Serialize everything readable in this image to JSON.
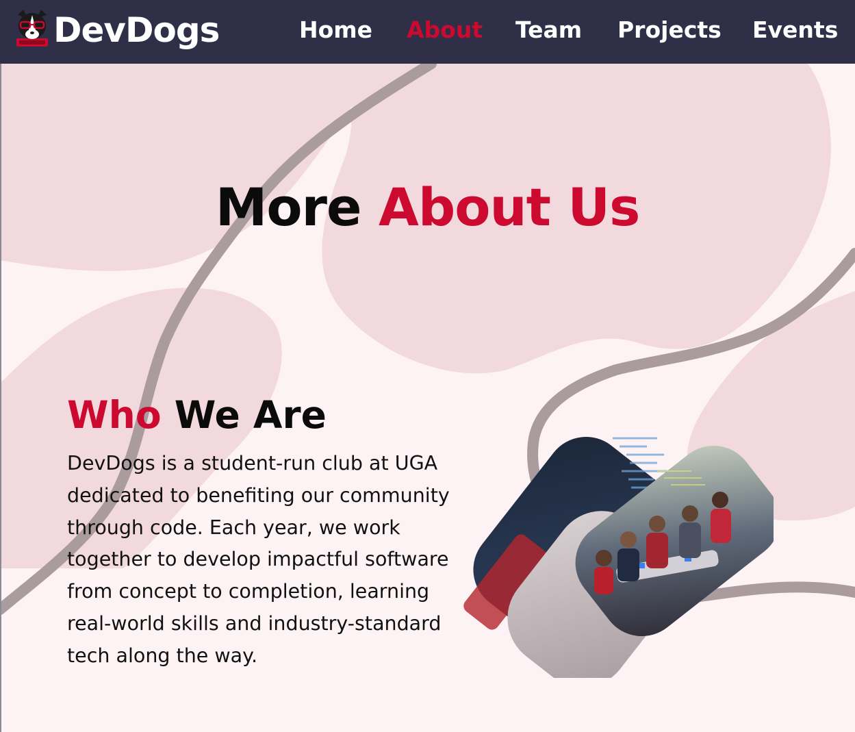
{
  "nav": {
    "brand": "DevDogs",
    "links": [
      {
        "label": "Home",
        "active": false
      },
      {
        "label": "About",
        "active": true
      },
      {
        "label": "Team",
        "active": false
      },
      {
        "label": "Projects",
        "active": false
      },
      {
        "label": "Events",
        "active": false
      }
    ]
  },
  "hero": {
    "title_part1": "More",
    "title_part2": "About Us"
  },
  "who": {
    "title_part1": "Who",
    "title_part2": "We Are",
    "description": "DevDogs is a student-run club at UGA dedicated to benefiting our community through code. Each year, we work together to develop impactful software from concept to completion, learning real-world skills and industry-standard tech along the way."
  },
  "colors": {
    "nav_bg": "#2f2f48",
    "accent": "#cc0a2f",
    "page_bg": "#fdf3f5",
    "blob": "#f1d9de",
    "ribbon": "#aa9b9f"
  }
}
